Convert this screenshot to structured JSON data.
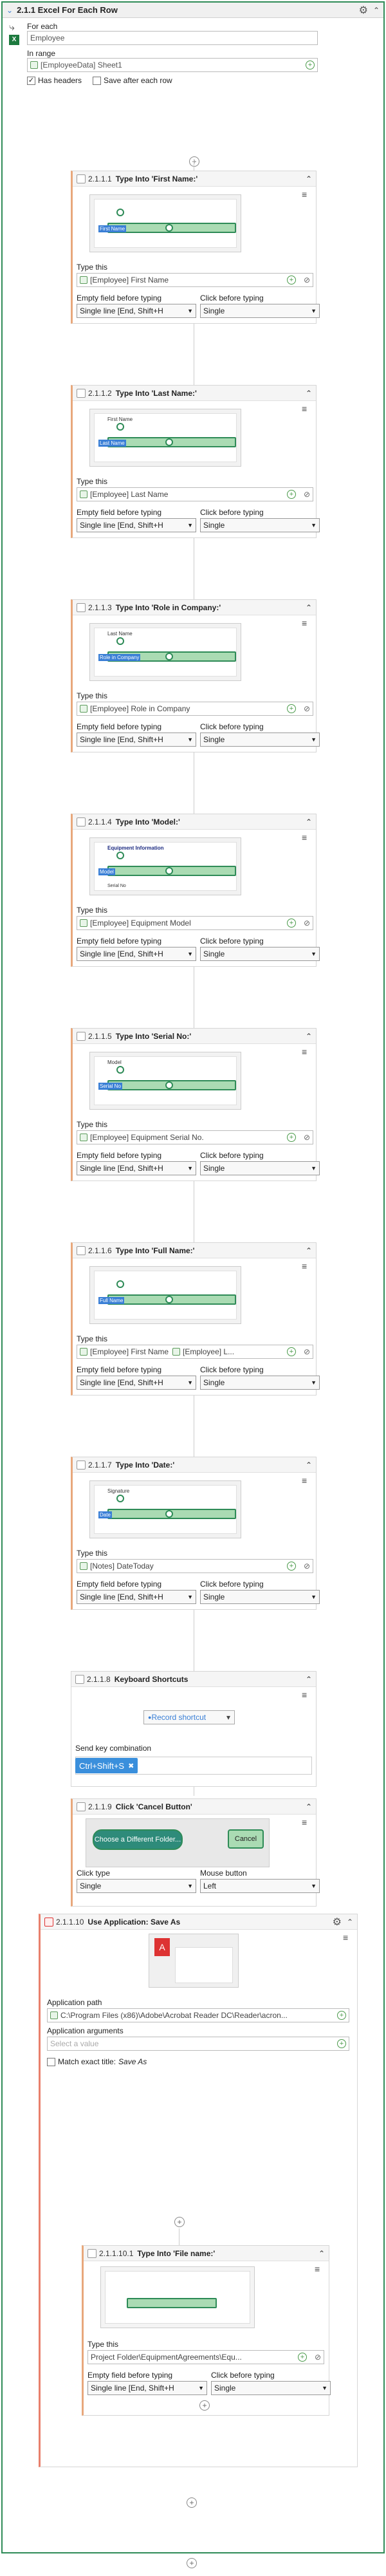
{
  "outer": {
    "title": "2.1.1  Excel For Each Row"
  },
  "foreach": {
    "for_each_label": "For each",
    "for_each_value": "Employee",
    "in_range_label": "In range",
    "in_range_value": "[EmployeeData] Sheet1",
    "has_headers": "Has headers",
    "save_after": "Save after each row"
  },
  "common": {
    "type_this": "Type this",
    "empty_field": "Empty field before typing",
    "click_before": "Click before typing",
    "empty_value": "Single line [End, Shift+H",
    "click_value": "Single"
  },
  "activities": [
    {
      "num": "2.1.1.1",
      "name": "Type Into 'First Name:'",
      "value": "[Employee] First Name",
      "thumb_label": "First Name"
    },
    {
      "num": "2.1.1.2",
      "name": "Type Into 'Last Name:'",
      "value": "[Employee] Last Name",
      "thumb_label": "Last Name",
      "thumb_top": "First Name"
    },
    {
      "num": "2.1.1.3",
      "name": "Type Into 'Role in Company:'",
      "value": "[Employee] Role in Company",
      "thumb_label": "Role in Company",
      "thumb_top": "Last Name"
    },
    {
      "num": "2.1.1.4",
      "name": "Type Into 'Model:'",
      "value": "[Employee] Equipment Model",
      "thumb_label": "Model",
      "thumb_top": "Equipment Information",
      "thumb_bottom": "Serial No"
    },
    {
      "num": "2.1.1.5",
      "name": "Type Into 'Serial No:'",
      "value": "[Employee] Equipment Serial No.",
      "thumb_label": "Serial No",
      "thumb_top": "Model"
    },
    {
      "num": "2.1.1.6",
      "name": "Type Into 'Full Name:'",
      "value_a": "[Employee] First Name",
      "value_b": "[Employee] L...",
      "thumb_label": "Full Name"
    },
    {
      "num": "2.1.1.7",
      "name": "Type Into 'Date:'",
      "value": "[Notes] DateToday",
      "thumb_label": "Date",
      "thumb_top": "Signature"
    }
  ],
  "keyboard": {
    "num": "2.1.1.8",
    "name": "Keyboard Shortcuts",
    "record": "Record shortcut",
    "send_label": "Send key combination",
    "combo": "Ctrl+Shift+S"
  },
  "click": {
    "num": "2.1.1.9",
    "name": "Click 'Cancel Button'",
    "thumb_choose": "Choose a Different Folder...",
    "thumb_cancel": "Cancel",
    "click_type_label": "Click type",
    "click_type_value": "Single",
    "mouse_label": "Mouse button",
    "mouse_value": "Left"
  },
  "app": {
    "num": "2.1.1.10",
    "name": "Use Application: Save As",
    "path_label": "Application path",
    "path_value": "C:\\Program Files (x86)\\Adobe\\Acrobat Reader DC\\Reader\\acron...",
    "args_label": "Application arguments",
    "args_placeholder": "Select a value",
    "match_label": "Match exact title:",
    "match_value": "Save As"
  },
  "nested": {
    "num": "2.1.1.10.1",
    "name": "Type Into 'File name:'",
    "value": "Project Folder\\EquipmentAgreements\\Equ..."
  }
}
